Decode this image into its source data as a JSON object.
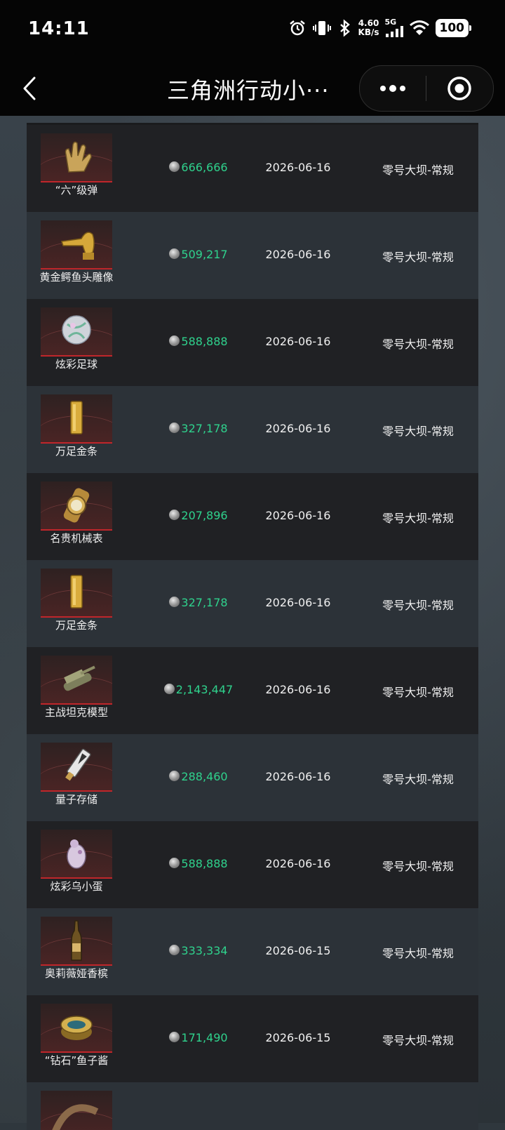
{
  "status_bar": {
    "time": "14:11",
    "net_speed_value": "4.60",
    "net_speed_unit": "KB/s",
    "network": "5G",
    "battery": "100"
  },
  "nav": {
    "title": "三角洲行动小···"
  },
  "colors": {
    "price": "#2fd28d",
    "accent_red": "#c0262b"
  },
  "records": [
    {
      "name": "“六”级弹",
      "icon": "hand-sign-icon",
      "price": "666,666",
      "date": "2026-06-16",
      "map": "零号大坝-常规"
    },
    {
      "name": "黄金鳄鱼头雕像",
      "icon": "gold-crocodile-head-icon",
      "price": "509,217",
      "date": "2026-06-16",
      "map": "零号大坝-常规"
    },
    {
      "name": "炫彩足球",
      "icon": "iridescent-ball-icon",
      "price": "588,888",
      "date": "2026-06-16",
      "map": "零号大坝-常规"
    },
    {
      "name": "万足金条",
      "icon": "gold-bar-icon",
      "price": "327,178",
      "date": "2026-06-16",
      "map": "零号大坝-常规"
    },
    {
      "name": "名贵机械表",
      "icon": "watch-icon",
      "price": "207,896",
      "date": "2026-06-16",
      "map": "零号大坝-常规"
    },
    {
      "name": "万足金条",
      "icon": "gold-bar-icon",
      "price": "327,178",
      "date": "2026-06-16",
      "map": "零号大坝-常规"
    },
    {
      "name": "主战坦克模型",
      "icon": "tank-model-icon",
      "price": "2,143,447",
      "date": "2026-06-16",
      "map": "零号大坝-常规"
    },
    {
      "name": "量子存储",
      "icon": "quantum-storage-icon",
      "price": "288,460",
      "date": "2026-06-16",
      "map": "零号大坝-常规"
    },
    {
      "name": "炫彩乌小蛋",
      "icon": "iridescent-egg-icon",
      "price": "588,888",
      "date": "2026-06-16",
      "map": "零号大坝-常规"
    },
    {
      "name": "奥莉薇娅香槟",
      "icon": "champagne-bottle-icon",
      "price": "333,334",
      "date": "2026-06-15",
      "map": "零号大坝-常规"
    },
    {
      "name": "“钻石”鱼子酱",
      "icon": "caviar-tin-icon",
      "price": "171,490",
      "date": "2026-06-15",
      "map": "零号大坝-常规"
    }
  ]
}
